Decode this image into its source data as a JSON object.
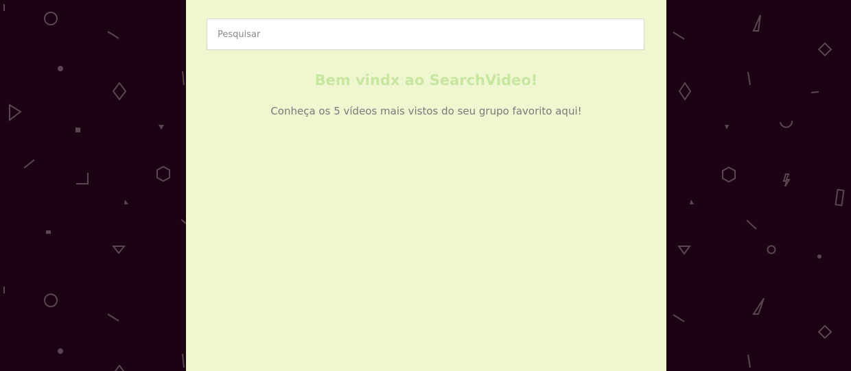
{
  "search": {
    "placeholder": "Pesquisar",
    "value": ""
  },
  "welcome": {
    "title": "Bem vindx ao SearchVideo!",
    "subtitle": "Conheça os 5 vídeos mais vistos do seu grupo favorito aqui!"
  },
  "colors": {
    "page_background": "#1c0212",
    "pattern": "#5b4653",
    "content_background": "#eff7d0",
    "title": "#c8e6a0",
    "subtitle": "#7a7a7a"
  },
  "decoration": {
    "pattern_icon": "geometric-confetti-pattern"
  }
}
